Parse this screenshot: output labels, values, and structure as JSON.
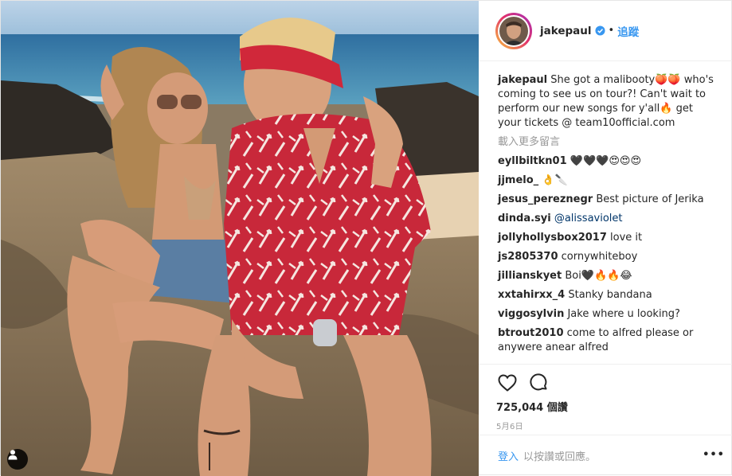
{
  "post": {
    "username": "jakepaul",
    "follow_label": "追蹤",
    "dot": "•",
    "caption": {
      "username": "jakepaul",
      "text": "She got a malibooty🍑🍑 who's coming to see us on tour?! Can't wait to perform our new songs for y'all🔥 get your tickets @ team10official.com"
    },
    "load_more": "載入更多留言",
    "comments": [
      {
        "username": "eyllbiltkn01",
        "text": "🖤🖤🖤😍😍😍"
      },
      {
        "username": "jjmelo_",
        "text": "👌🔪"
      },
      {
        "username": "jesus_pereznegr",
        "text": "Best picture of Jerika"
      },
      {
        "username": "dinda.syi",
        "text": "@alissaviolet"
      },
      {
        "username": "jollyhollysbox2017",
        "text": "love it"
      },
      {
        "username": "js2805370",
        "text": "cornywhiteboy"
      },
      {
        "username": "jillianskyet",
        "text": "Boi🖤🔥🔥😂"
      },
      {
        "username": "xxtahirxx_4",
        "text": "Stanky bandana"
      },
      {
        "username": "viggosylvin",
        "text": "Jake where u looking?"
      },
      {
        "username": "btrout2010",
        "text": "come to alfred please or anywere anear alfred"
      }
    ],
    "likes": "725,044 個讚",
    "date": "5月6日",
    "login_label": "登入",
    "login_rest": "以按讚或回應。",
    "more_label": "•••"
  },
  "icons": {
    "verified": "verified-badge-icon",
    "like": "heart-icon",
    "comment": "comment-bubble-icon",
    "tag": "user-tag-icon"
  },
  "colors": {
    "link": "#3897f0",
    "mention": "#003569",
    "muted": "#999999",
    "text": "#262626"
  }
}
